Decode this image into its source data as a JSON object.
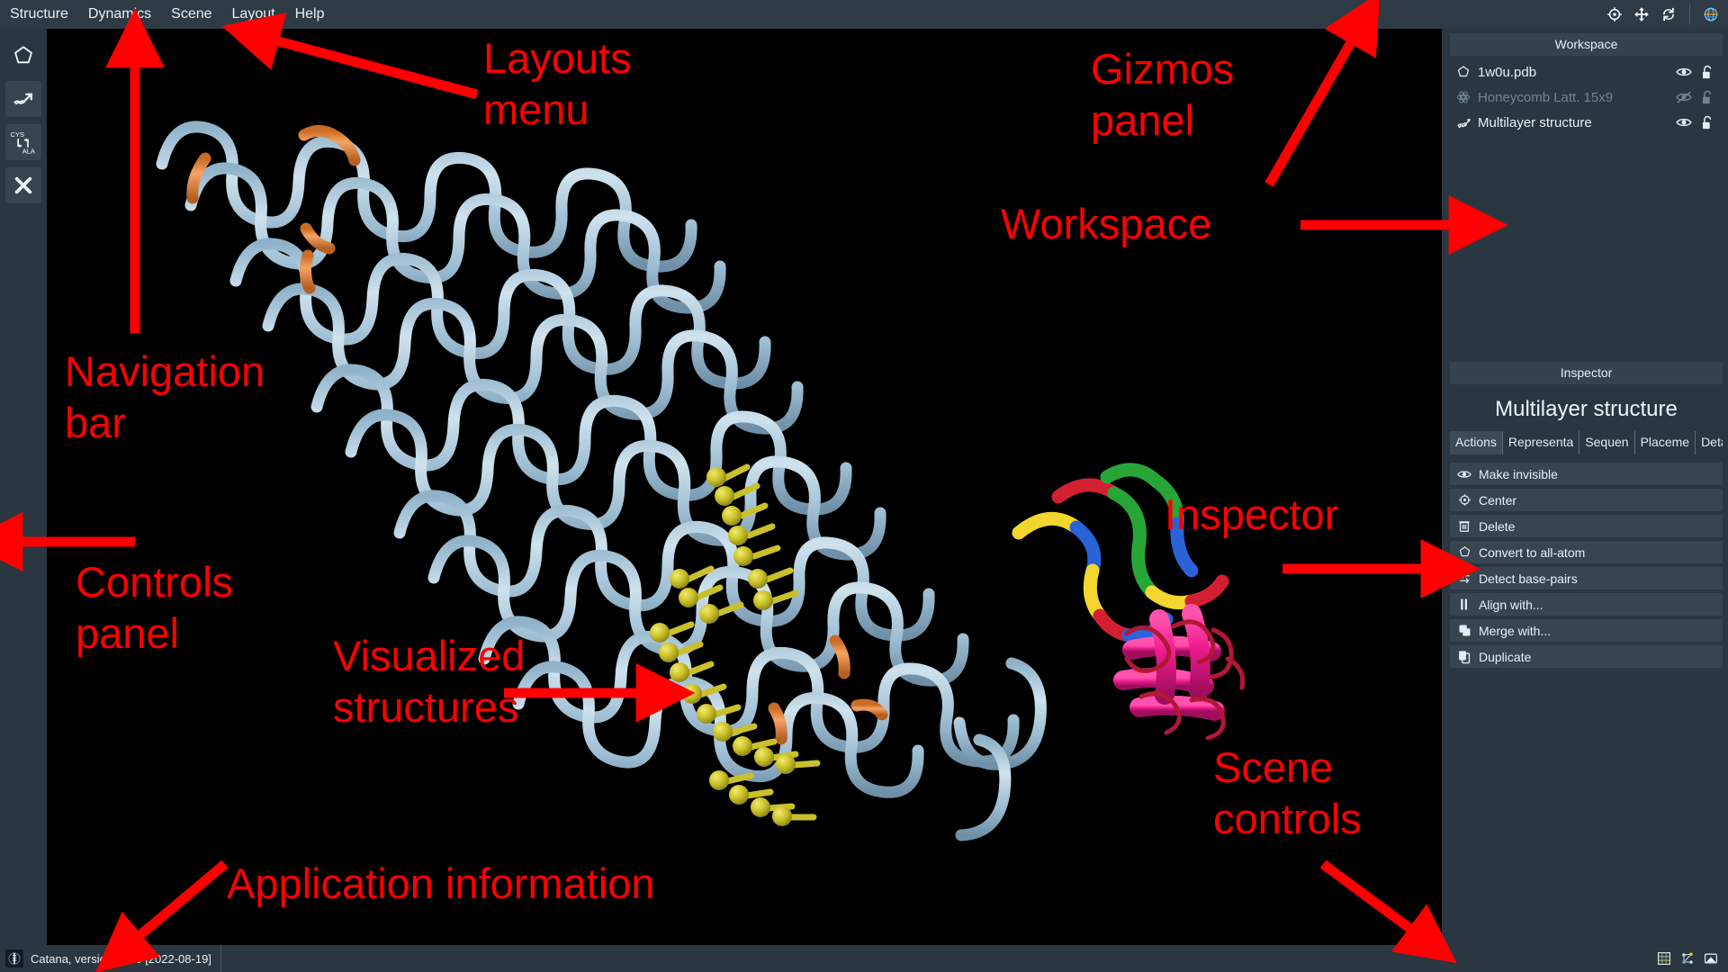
{
  "app": {
    "title": "Catana",
    "status_text": "Catana, version 1.1.0 [2022-08-19]"
  },
  "menubar": {
    "items": [
      {
        "label": "Structure"
      },
      {
        "label": "Dynamics"
      },
      {
        "label": "Scene"
      },
      {
        "label": "Layout"
      },
      {
        "label": "Help"
      }
    ]
  },
  "gizmos": {
    "items": [
      {
        "name": "center-gizmo-icon",
        "label": "Center"
      },
      {
        "name": "move-gizmo-icon",
        "label": "Move"
      },
      {
        "name": "rotate-gizmo-icon",
        "label": "Rotate"
      },
      {
        "name": "globe-gizmo-icon",
        "label": "Global"
      }
    ]
  },
  "navbar": {
    "items": [
      {
        "name": "create-shape-tool",
        "label": "Create shape",
        "active": false
      },
      {
        "name": "dna-extend-tool",
        "label": "Extend DNA",
        "active": true
      },
      {
        "name": "mutate-residue-tool",
        "label": "Mutate residue (CYS / ALA)",
        "active": true,
        "top_text": "CYS",
        "bottom_text": "ALA"
      },
      {
        "name": "remove-tool",
        "label": "Remove",
        "active": true
      }
    ]
  },
  "workspace": {
    "title": "Workspace",
    "rows": [
      {
        "label": "1w0u.pdb",
        "icon": "star-outline-icon",
        "visible": true,
        "locked": false,
        "dim": false
      },
      {
        "label": "Honeycomb Latt. 15x9",
        "icon": "lattice-icon",
        "visible": false,
        "locked": false,
        "dim": true
      },
      {
        "label": "Multilayer structure",
        "icon": "helix-icon",
        "visible": true,
        "locked": false,
        "dim": false
      }
    ]
  },
  "inspector": {
    "title": "Inspector",
    "selected_name": "Multilayer structure",
    "tabs": [
      {
        "label": "Actions",
        "active": true
      },
      {
        "label": "Representa",
        "active": false
      },
      {
        "label": "Sequen",
        "active": false
      },
      {
        "label": "Placeme",
        "active": false
      },
      {
        "label": "Detai",
        "active": false
      }
    ],
    "actions": [
      {
        "label": "Make invisible",
        "icon": "eye-icon"
      },
      {
        "label": "Center",
        "icon": "center-target-icon"
      },
      {
        "label": "Delete",
        "icon": "trash-icon"
      },
      {
        "label": "Convert to all-atom",
        "icon": "star-outline-icon"
      },
      {
        "label": "Detect base-pairs",
        "icon": "swap-arrows-icon"
      },
      {
        "label": "Align with...",
        "icon": "align-bars-icon"
      },
      {
        "label": "Merge with...",
        "icon": "merge-squares-icon"
      },
      {
        "label": "Duplicate",
        "icon": "copy-icon"
      }
    ]
  },
  "scene_controls": {
    "items": [
      {
        "name": "grid-toggle-icon",
        "label": "Toggle grid"
      },
      {
        "name": "tree-view-icon",
        "label": "Scene tree"
      },
      {
        "name": "screenshot-icon",
        "label": "Screenshot"
      }
    ]
  },
  "annotations": [
    {
      "text": "Layouts\nmenu",
      "name": "annotation-layouts-menu"
    },
    {
      "text": "Gizmos\npanel",
      "name": "annotation-gizmos-panel"
    },
    {
      "text": "Workspace",
      "name": "annotation-workspace"
    },
    {
      "text": "Navigation\nbar",
      "name": "annotation-navigation-bar"
    },
    {
      "text": "Controls\npanel",
      "name": "annotation-controls-panel"
    },
    {
      "text": "Inspector",
      "name": "annotation-inspector"
    },
    {
      "text": "Visualized\nstructures",
      "name": "annotation-visualized-structures"
    },
    {
      "text": "Scene\ncontrols",
      "name": "annotation-scene-controls"
    },
    {
      "text": "Application information",
      "name": "annotation-application-information"
    }
  ],
  "colors": {
    "annotation_red": "#ff0000",
    "panel_bg": "#2b3740",
    "panel_header": "#34434e",
    "viewport_bg": "#000000",
    "dna_blue": "#a8c6da",
    "crossover_orange": "#e8883c",
    "strand_yellow": "#cbc230",
    "protein_magenta": "#e61a8d"
  }
}
